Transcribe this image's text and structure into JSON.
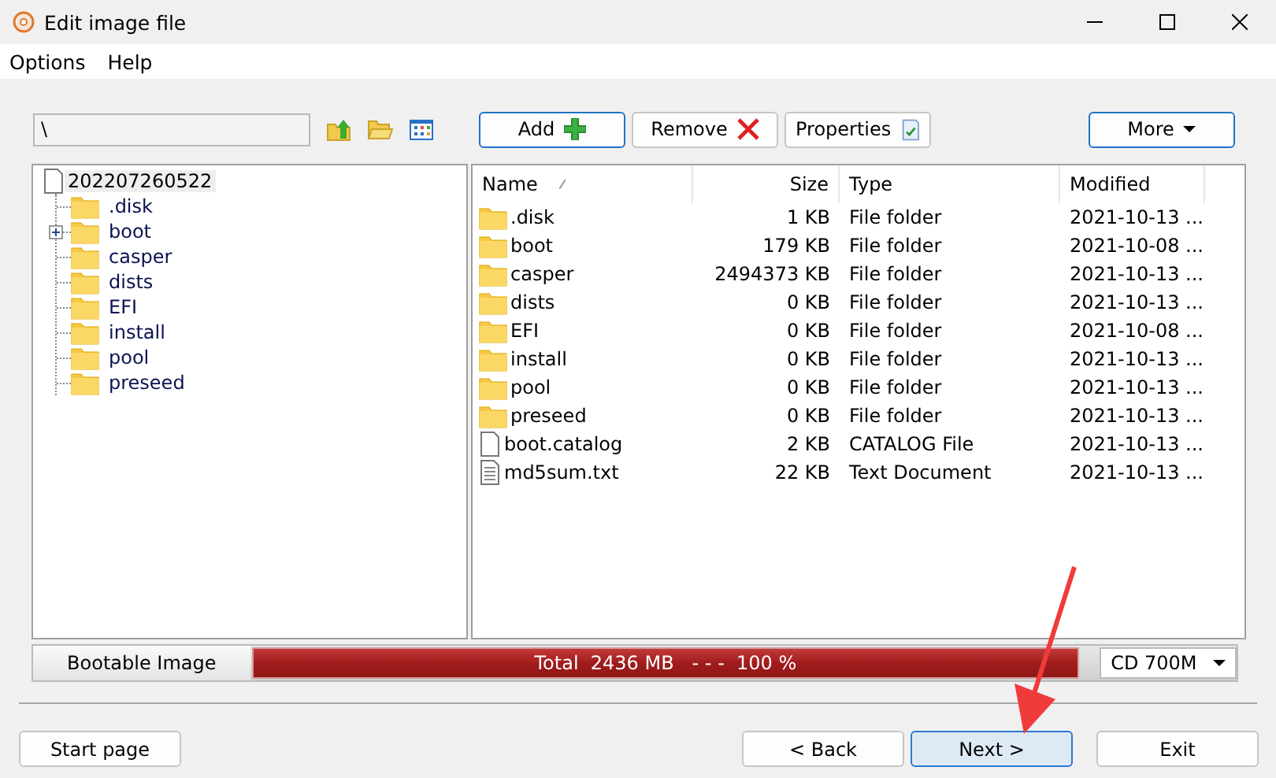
{
  "window": {
    "title": "Edit image file"
  },
  "menu": [
    "Options",
    "Help"
  ],
  "path_field": {
    "value": "\\"
  },
  "toolbar_buttons": [
    {
      "label": "Add",
      "kind": "add",
      "highlighted": true
    },
    {
      "label": "Remove",
      "kind": "remove",
      "highlighted": false
    },
    {
      "label": "Properties",
      "kind": "properties",
      "highlighted": false
    }
  ],
  "more_button": {
    "label": "More",
    "highlighted": true
  },
  "tree": {
    "label": "202207260522",
    "selected": true,
    "children": [
      {
        "label": ".disk",
        "expandable": false
      },
      {
        "label": "boot",
        "expandable": true
      },
      {
        "label": "casper",
        "expandable": false
      },
      {
        "label": "dists",
        "expandable": false
      },
      {
        "label": "EFI",
        "expandable": false
      },
      {
        "label": "install",
        "expandable": false
      },
      {
        "label": "pool",
        "expandable": false
      },
      {
        "label": "preseed",
        "expandable": false
      }
    ]
  },
  "table": {
    "columns": [
      "Name",
      "Size",
      "Type",
      "Modified"
    ],
    "rows": [
      {
        "kind": "folder",
        "name": ".disk",
        "size": "1 KB",
        "type": "File folder",
        "modified": "2021-10-13 ..."
      },
      {
        "kind": "folder",
        "name": "boot",
        "size": "179 KB",
        "type": "File folder",
        "modified": "2021-10-08 ..."
      },
      {
        "kind": "folder",
        "name": "casper",
        "size": "2494373 KB",
        "type": "File folder",
        "modified": "2021-10-13 ..."
      },
      {
        "kind": "folder",
        "name": "dists",
        "size": "0 KB",
        "type": "File folder",
        "modified": "2021-10-13 ..."
      },
      {
        "kind": "folder",
        "name": "EFI",
        "size": "0 KB",
        "type": "File folder",
        "modified": "2021-10-08 ..."
      },
      {
        "kind": "folder",
        "name": "install",
        "size": "0 KB",
        "type": "File folder",
        "modified": "2021-10-13 ..."
      },
      {
        "kind": "folder",
        "name": "pool",
        "size": "0 KB",
        "type": "File folder",
        "modified": "2021-10-13 ..."
      },
      {
        "kind": "folder",
        "name": "preseed",
        "size": "0 KB",
        "type": "File folder",
        "modified": "2021-10-13 ..."
      },
      {
        "kind": "file",
        "name": "boot.catalog",
        "size": "2 KB",
        "type": "CATALOG File",
        "modified": "2021-10-13 ..."
      },
      {
        "kind": "text",
        "name": "md5sum.txt",
        "size": "22 KB",
        "type": "Text Document",
        "modified": "2021-10-13 ..."
      }
    ]
  },
  "status": {
    "label": "Bootable Image",
    "progress_text": "Total  2436 MB   - - -  100 %",
    "level": 1,
    "media": "CD 700M"
  },
  "bottom_buttons": [
    {
      "label": "Start page",
      "focused": false
    },
    {
      "label": "< Back",
      "focused": false
    },
    {
      "label": "Next >",
      "focused": true
    },
    {
      "label": "Exit",
      "focused": false
    }
  ]
}
